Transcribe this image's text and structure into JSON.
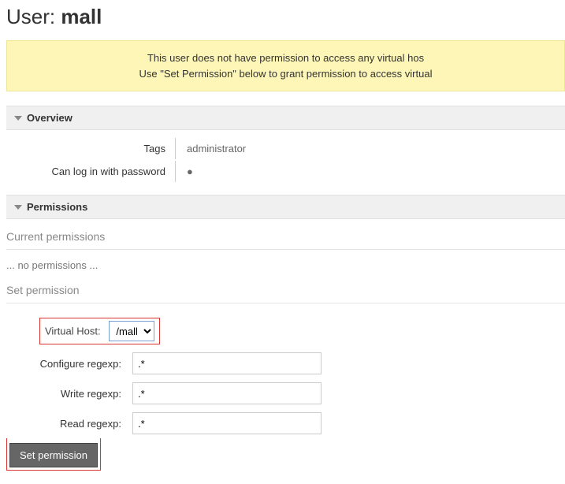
{
  "header": {
    "prefix": "User: ",
    "username": "mall"
  },
  "warning": {
    "line1": "This user does not have permission to access any virtual hos",
    "line2": "Use \"Set Permission\" below to grant permission to access virtual"
  },
  "overview": {
    "title": "Overview",
    "tags_label": "Tags",
    "tags_value": "administrator",
    "login_label": "Can log in with password",
    "login_value": "●"
  },
  "permissions": {
    "title": "Permissions",
    "current_title": "Current permissions",
    "none_text": "... no permissions ...",
    "set_title": "Set permission",
    "vhost_label": "Virtual Host:",
    "vhost_value": "/mall",
    "configure_label": "Configure regexp:",
    "configure_value": ".*",
    "write_label": "Write regexp:",
    "write_value": ".*",
    "read_label": "Read regexp:",
    "read_value": ".*",
    "button": "Set permission"
  }
}
